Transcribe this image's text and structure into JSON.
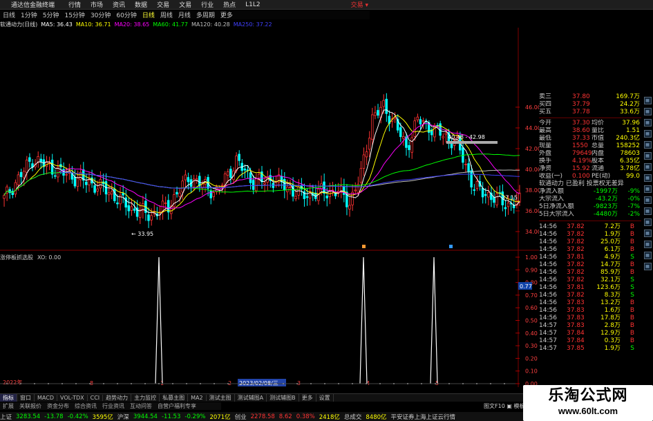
{
  "app": {
    "title": "通达信金融终端"
  },
  "menu": {
    "items": [
      "行情",
      "市场",
      "资讯",
      "数据",
      "交易",
      "文易",
      "行业",
      "热点",
      "L1L2"
    ],
    "right_label": "交易 ▾"
  },
  "period_tabs": [
    "日线",
    "1分钟",
    "5分钟",
    "15分钟",
    "30分钟",
    "60分钟",
    "日线",
    "周线",
    "月线",
    "多周期",
    "更多"
  ],
  "period_active": 6,
  "main_header": {
    "stock": "软通动力(日线)",
    "ma": [
      {
        "label": "MA5: 36.43",
        "color": "#ffffff"
      },
      {
        "label": "MA10: 36.71",
        "color": "#ffff00"
      },
      {
        "label": "MA20: 38.65",
        "color": "#ff00ff"
      },
      {
        "label": "MA60: 41.77",
        "color": "#00ff00"
      },
      {
        "label": "MA120: 40.28",
        "color": "#c0c0c0"
      },
      {
        "label": "MA250: 37.22",
        "color": "#4040ff"
      }
    ]
  },
  "annotations": {
    "low_label": "← 33.95",
    "range_label": "40.48 - 42.98",
    "last_label": "37.15",
    "sub_value": "0.77",
    "date_label": "2023/02/08/三",
    "year_label": "2022年"
  },
  "sub_header": {
    "name": "涨停板抓选股",
    "value": "XO: 0.00"
  },
  "right_axis_main": [
    "46.00",
    "44.00",
    "42.00",
    "40.00",
    "38.00",
    "36.00",
    "34.00"
  ],
  "right_axis_sub": [
    "1.00",
    "0.90",
    "0.80",
    "0.70",
    "0.60",
    "0.50",
    "0.40",
    "0.30",
    "0.20",
    "0.10",
    "0.00"
  ],
  "x_markers": [
    "8",
    "1",
    "2",
    "3",
    "4",
    "5"
  ],
  "quote_panel": {
    "bids": [
      {
        "label": "卖三",
        "price": "37.80",
        "vol": "169.7万"
      },
      {
        "label": "买四",
        "price": "37.79",
        "vol": "24.2万"
      },
      {
        "label": "买五",
        "price": "37.78",
        "vol": "33.6万"
      }
    ],
    "stats": [
      {
        "k1": "今开",
        "v1": "37.30",
        "k2": "均价",
        "v2": "37.96"
      },
      {
        "k1": "最高",
        "v1": "38.60",
        "k2": "量比",
        "v2": "1.51"
      },
      {
        "k1": "最低",
        "v1": "37.33",
        "k2": "市值",
        "v2": "240.3亿"
      },
      {
        "k1": "现量",
        "v1": "1550",
        "k2": "总量",
        "v2": "158252"
      },
      {
        "k1": "外盘",
        "v1": "79649",
        "k2": "内盘",
        "v2": "78603"
      },
      {
        "k1": "换手",
        "v1": "4.19%",
        "k2": "股本",
        "v2": "6.35亿"
      },
      {
        "k1": "净资",
        "v1": "15.92",
        "k2": "流通",
        "v2": "3.78亿"
      },
      {
        "k1": "收益(一)",
        "v1": "0.100",
        "k2": "PE(动)",
        "v2": "99.0"
      }
    ],
    "info_line": "软通动力 已盈利 投票权无差异",
    "flows": [
      {
        "label": "净流入额",
        "value": "-1997万",
        "pct": "-9%"
      },
      {
        "label": "大宗流入",
        "value": "-43.2万",
        "pct": "-0%"
      },
      {
        "label": "5日净流入额",
        "value": "-9823万",
        "pct": "-7%"
      },
      {
        "label": "5日大宗流入",
        "value": "-4480万",
        "pct": "-2%"
      }
    ],
    "ticks": [
      {
        "t": "14:56",
        "p": "37.82",
        "v": "7.2万",
        "s": "B"
      },
      {
        "t": "14:56",
        "p": "37.82",
        "v": "1.9万",
        "s": "B"
      },
      {
        "t": "14:56",
        "p": "37.82",
        "v": "25.0万",
        "s": "B"
      },
      {
        "t": "14:56",
        "p": "37.82",
        "v": "6.1万",
        "s": "B"
      },
      {
        "t": "14:56",
        "p": "37.81",
        "v": "4.9万",
        "s": "S"
      },
      {
        "t": "14:56",
        "p": "37.82",
        "v": "14.7万",
        "s": "B"
      },
      {
        "t": "14:56",
        "p": "37.82",
        "v": "85.9万",
        "s": "B"
      },
      {
        "t": "14:56",
        "p": "37.82",
        "v": "32.1万",
        "s": "S"
      },
      {
        "t": "14:56",
        "p": "37.81",
        "v": "123.6万",
        "s": "S"
      },
      {
        "t": "14:56",
        "p": "37.82",
        "v": "8.3万",
        "s": "S"
      },
      {
        "t": "14:56",
        "p": "37.83",
        "v": "13.2万",
        "s": "B"
      },
      {
        "t": "14:56",
        "p": "37.83",
        "v": "1.6万",
        "s": "B"
      },
      {
        "t": "14:56",
        "p": "37.83",
        "v": "17.8万",
        "s": "B"
      },
      {
        "t": "14:57",
        "p": "37.83",
        "v": "2.8万",
        "s": "B"
      },
      {
        "t": "14:57",
        "p": "37.84",
        "v": "12.9万",
        "s": "B"
      },
      {
        "t": "14:57",
        "p": "37.84",
        "v": "0.3万",
        "s": "B"
      },
      {
        "t": "14:57",
        "p": "37.85",
        "v": "1.9万",
        "s": "S"
      }
    ]
  },
  "tabs": [
    "指标",
    "窗口",
    "MACD",
    "VOL-TDX",
    "CCI",
    "趋势动力",
    "主力监控",
    "私募主图",
    "MA2",
    "测试主图",
    "测试辅图A",
    "测试辅图B",
    "更多",
    "设置"
  ],
  "tabs_active": 0,
  "subtabs": [
    "扩展",
    "关联报价",
    "资金分布",
    "综合资讯",
    "行业资讯",
    "互动问答",
    "自营户福利专享"
  ],
  "bottom_right": "图文F10 ▣ 模板",
  "status": [
    {
      "text": "上证",
      "color": "#cccccc"
    },
    {
      "text": "3283.54",
      "color": "#00ff00"
    },
    {
      "text": "-13.78",
      "color": "#00ff00"
    },
    {
      "text": "-0.42%",
      "color": "#00ff00"
    },
    {
      "text": "3595亿",
      "color": "#ffff00"
    },
    {
      "text": "沪深",
      "color": "#cccccc"
    },
    {
      "text": "3944.54",
      "color": "#00ff00"
    },
    {
      "text": "-11.53",
      "color": "#00ff00"
    },
    {
      "text": "-0.29%",
      "color": "#00ff00"
    },
    {
      "text": "2071亿",
      "color": "#ffff00"
    },
    {
      "text": "创业",
      "color": "#cccccc"
    },
    {
      "text": "2278.58",
      "color": "#ff3333"
    },
    {
      "text": "8.62",
      "color": "#ff3333"
    },
    {
      "text": "0.38%",
      "color": "#ff3333"
    },
    {
      "text": "2418亿",
      "color": "#ffff00"
    },
    {
      "text": "总成交",
      "color": "#cccccc"
    },
    {
      "text": "8480亿",
      "color": "#ffff00"
    },
    {
      "text": "平安证券上海上证云行情",
      "color": "#cccccc"
    }
  ],
  "watermark": {
    "title": "乐淘公式网",
    "url": "www.60lt.com"
  },
  "colors": {
    "up": "#ff3333",
    "down": "#00ffff",
    "grid": "#800000"
  }
}
